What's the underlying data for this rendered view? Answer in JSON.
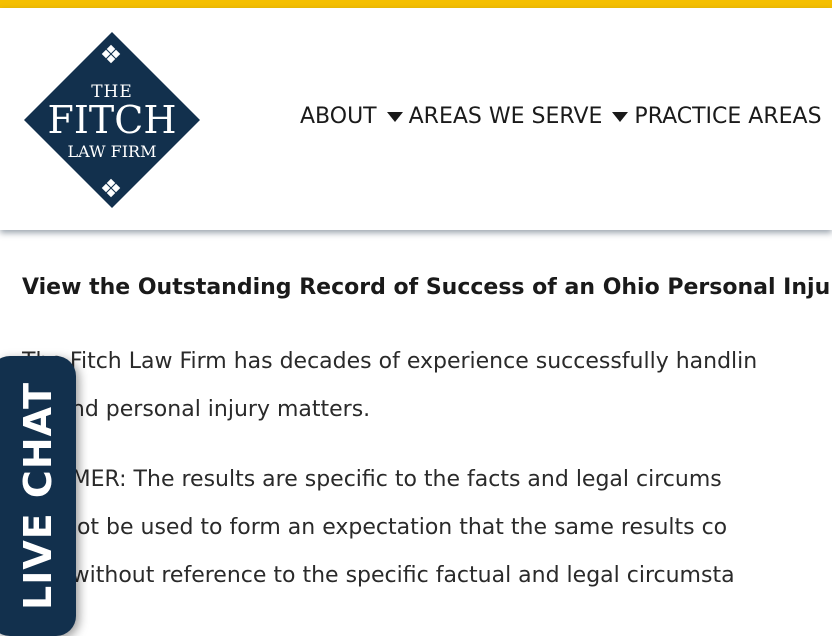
{
  "colors": {
    "accent_bar": "#f5bf00",
    "brand_navy": "#12304d",
    "text": "#1a1a1a"
  },
  "logo": {
    "line1": "THE",
    "line2": "FITCH",
    "line3": "LAW FIRM"
  },
  "nav": {
    "items": [
      {
        "label": "ABOUT",
        "has_dropdown": true,
        "icon": "caret-down-icon"
      },
      {
        "label": "AREAS WE SERVE",
        "has_dropdown": true,
        "icon": "caret-down-icon"
      },
      {
        "label": "PRACTICE AREAS",
        "has_dropdown": false
      }
    ]
  },
  "main": {
    "headline": "View the Outstanding Record of Success of an Ohio Personal Inju",
    "paragraph1": {
      "line1": "The Fitch Law Firm has decades of experience successfully handlin",
      "line2": "m, and personal injury matters."
    },
    "disclaimer": {
      "line1": "CLAIMER: The results are specific to the facts and legal circums",
      "line2": "uld not be used to form an expectation that the same results co",
      "line3": "ters without reference to the specific factual and legal circumsta"
    }
  },
  "live_chat": {
    "label": "LIVE CHAT"
  }
}
